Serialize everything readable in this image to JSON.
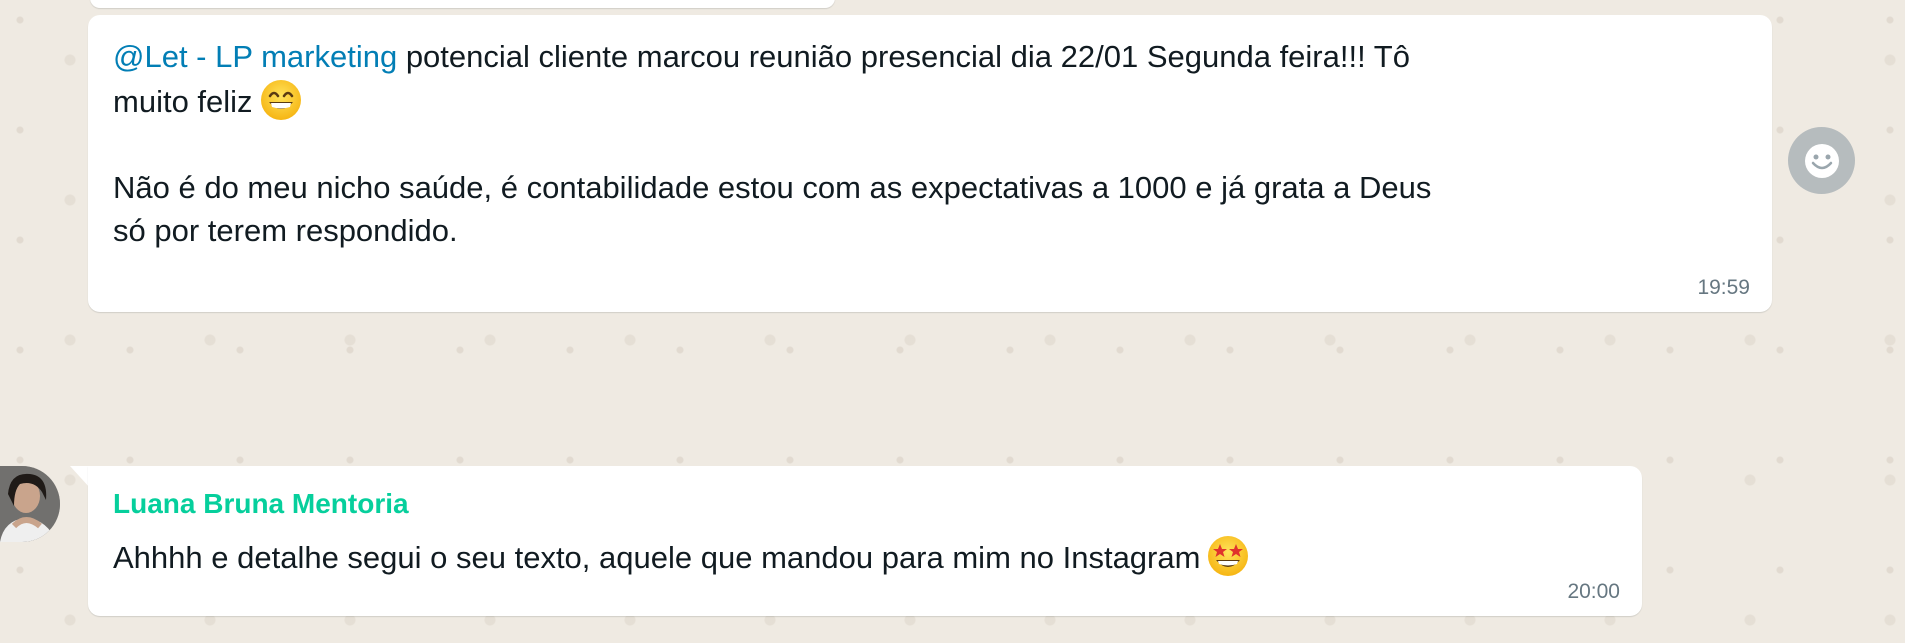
{
  "chat": {
    "messages": [
      {
        "mention": "@Let - LP marketing",
        "line1_text": " potencial cliente marcou reunião presencial dia 22/01 Segunda feira!!! Tô",
        "line2_text": "muito feliz",
        "emoji_icon": "grinning-face-with-smiling-eyes-icon",
        "paragraph2": "Não é do meu nicho saúde, é contabilidade estou com as expectativas a 1000 e já grata a Deus\nsó por terem respondido.",
        "time": "19:59"
      },
      {
        "sender": "Luana Bruna Mentoria",
        "sender_color": "#06cf9c",
        "text": "Ahhhh e detalhe segui o seu texto, aquele que mandou para mim no Instagram",
        "emoji_icon": "star-struck-face-icon",
        "time": "20:00"
      }
    ],
    "react_button_icon": "smiley-icon"
  },
  "colors": {
    "background": "#efeae2",
    "bubble": "#ffffff",
    "mention": "#027eb5",
    "timestamp": "#667781",
    "text": "#111b21"
  }
}
